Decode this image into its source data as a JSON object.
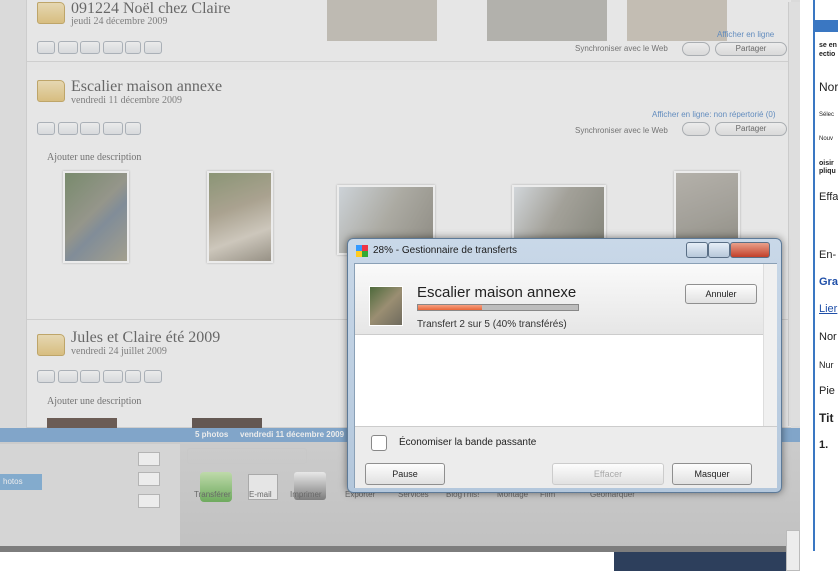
{
  "albums": [
    {
      "title": "091224 Noël chez Claire",
      "date": "jeudi 24 décembre 2009",
      "link": "Afficher en ligne",
      "sync": "Synchroniser avec le Web",
      "share": "Partager"
    },
    {
      "title": "Escalier maison annexe",
      "date": "vendredi 11 décembre 2009",
      "link": "Afficher en ligne: non répertorié (0)",
      "sync": "Synchroniser avec le Web",
      "share": "Partager",
      "desc": "Ajouter une description"
    },
    {
      "title": "Jules et Claire été 2009",
      "date": "vendredi 24 juillet 2009",
      "desc": "Ajouter une description"
    }
  ],
  "status_bar": {
    "count": "5 photos",
    "date": "vendredi 11 décembre 2009"
  },
  "left_label": "hotos",
  "tools": [
    "Transférer",
    "E-mail",
    "Imprimer",
    "Exporter",
    "Services",
    "BlogThis!",
    "Montage",
    "Film",
    "Géomarquer"
  ],
  "dialog": {
    "title": "28% - Gestionnaire de transferts",
    "item_title": "Escalier maison annexe",
    "progress_text": "Transfert 2 sur 5 (40% transférés)",
    "progress": 0.4,
    "cancel": "Annuler",
    "bandwidth": "Économiser la bande passante",
    "pause": "Pause",
    "erase": "Effacer",
    "hide": "Masquer"
  },
  "right_panel": {
    "lines": [
      "se en",
      "ectio",
      "Nor",
      "Sélec",
      "Nouv",
      "oisir",
      "pliqu",
      "Effa",
      "En-",
      "Gra",
      "Lier",
      "Nor",
      "Nur",
      "Pie",
      "Tit",
      "1."
    ]
  }
}
